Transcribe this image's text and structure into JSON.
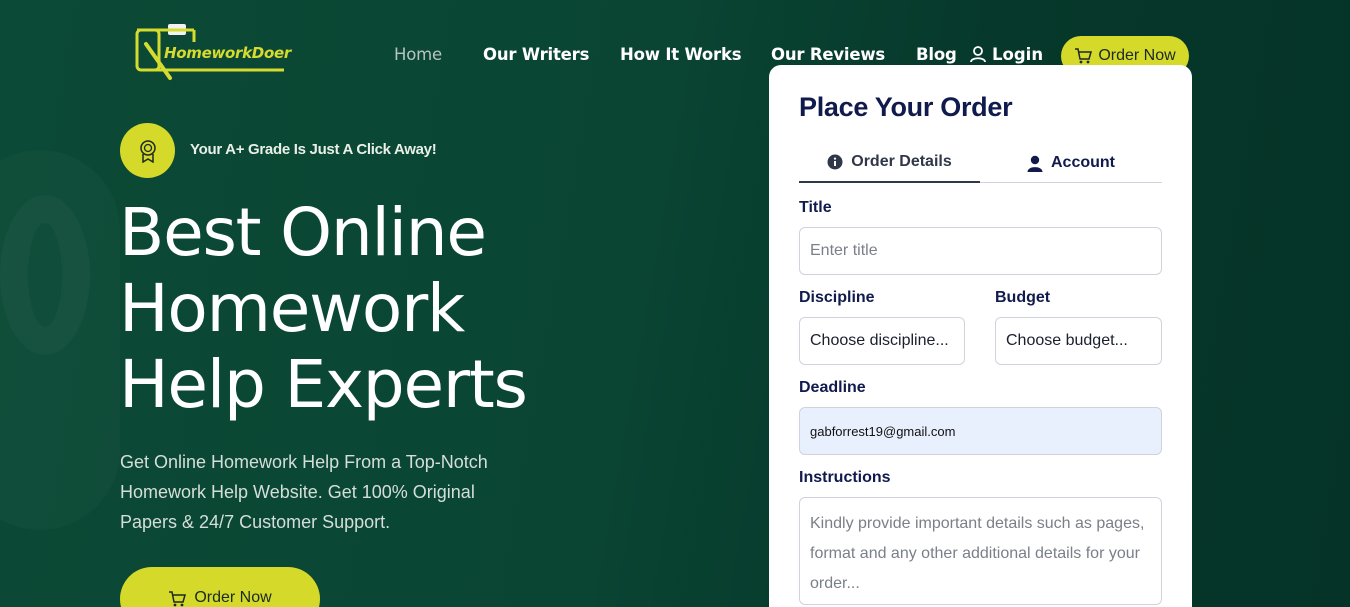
{
  "brand": {
    "logo_text": "HomeworkDoer",
    "accent": "#d4d92a",
    "background": "#0b4a37"
  },
  "nav": {
    "items": [
      {
        "label": "Home",
        "active": true
      },
      {
        "label": "Our Writers",
        "active": false
      },
      {
        "label": "How It Works",
        "active": false
      },
      {
        "label": "Our Reviews",
        "active": false
      },
      {
        "label": "Blog",
        "active": false
      }
    ],
    "login_label": "Login",
    "login_icon": "user-icon",
    "order_label": "Order Now",
    "order_icon": "cart-icon"
  },
  "hero": {
    "badge_icon": "award-icon",
    "badge_text": "Your A+ Grade Is Just A Click Away!",
    "title_line1": "Best Online",
    "title_line2": "Homework",
    "title_line3": "Help Experts",
    "description": "Get Online Homework Help From a Top-Notch Homework Help Website. Get 100% Original Papers & 24/7 Customer Support.",
    "cta_label": "Order Now",
    "cta_icon": "cart-icon"
  },
  "order_form": {
    "title": "Place Your Order",
    "tabs": [
      {
        "label": "Order Details",
        "icon": "info-icon",
        "active": true
      },
      {
        "label": "Account",
        "icon": "user-icon",
        "active": false
      }
    ],
    "title_label": "Title",
    "title_placeholder": "Enter title",
    "discipline_label": "Discipline",
    "discipline_value": "Choose discipline...",
    "budget_label": "Budget",
    "budget_value": "Choose budget...",
    "deadline_label": "Deadline",
    "deadline_value": "gabforrest19@gmail.com",
    "instructions_label": "Instructions",
    "instructions_placeholder": "Kindly provide important details such as pages, format and any other additional details for your order..."
  }
}
